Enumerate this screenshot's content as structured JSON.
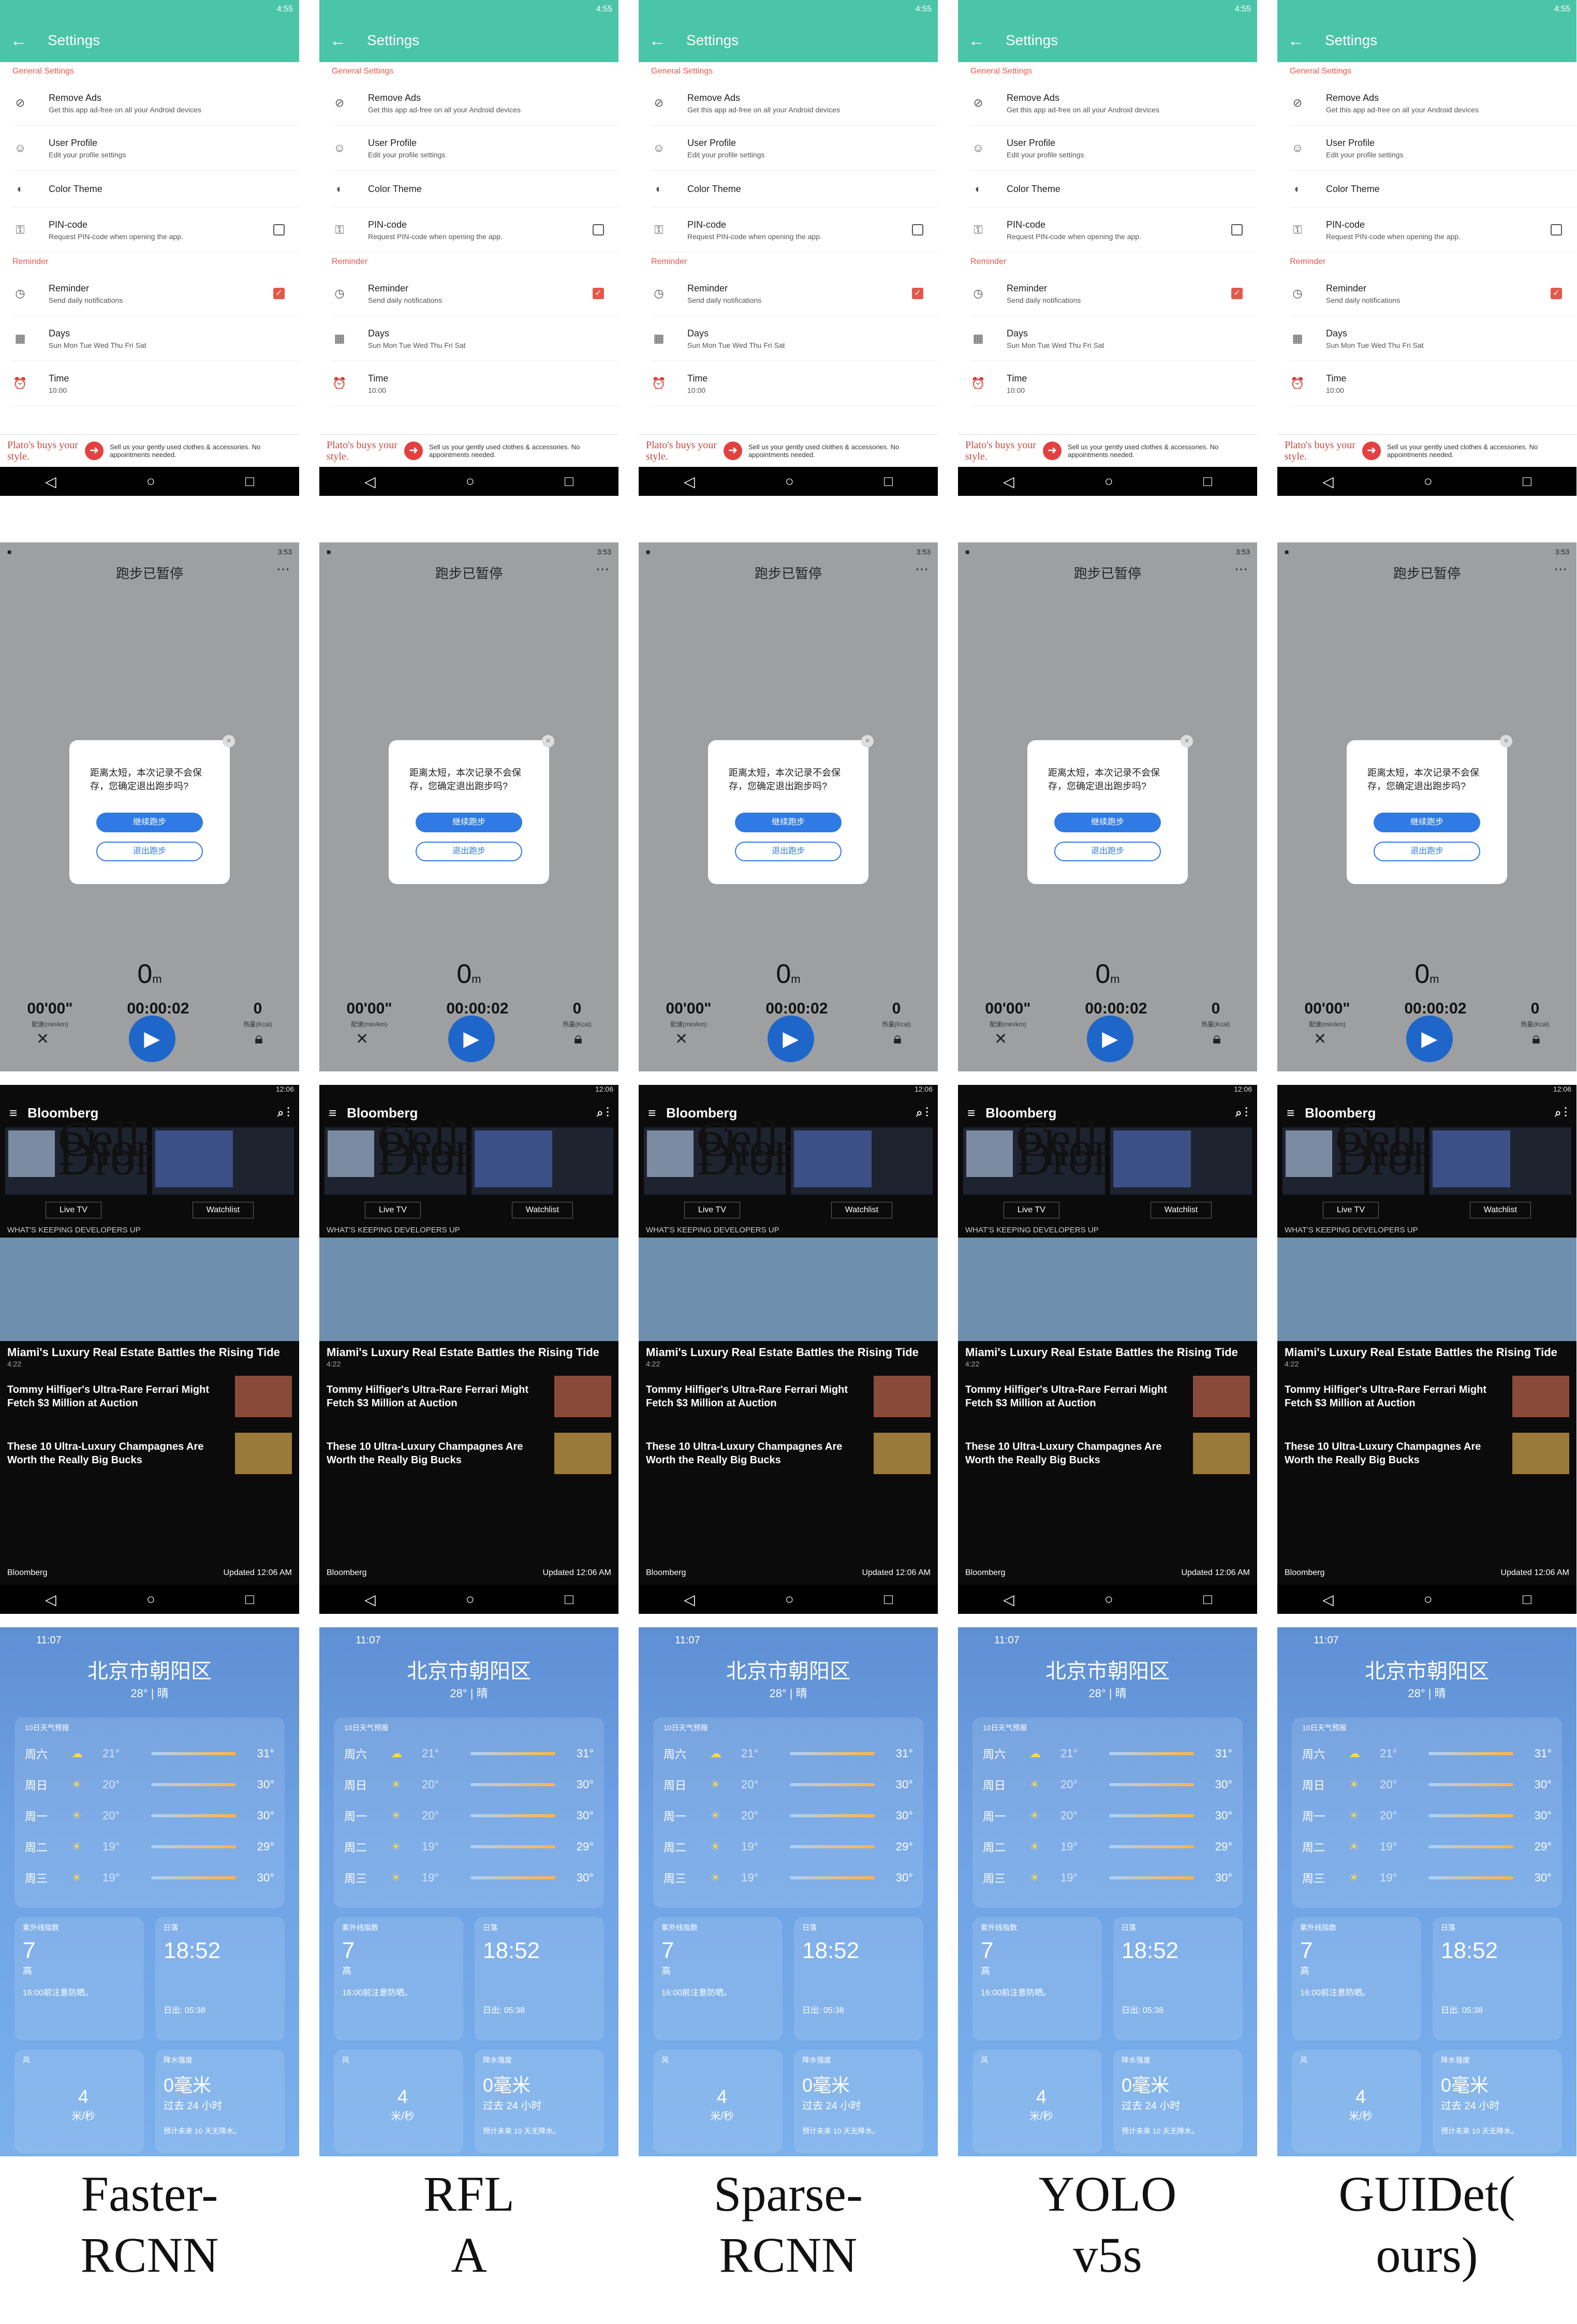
{
  "settings": {
    "time": "4:55",
    "title": "Settings",
    "section_general": "General Settings",
    "items": [
      {
        "title": "Remove Ads",
        "sub": "Get this app ad-free on all your Android devices",
        "icon": "ad-icon"
      },
      {
        "title": "User Profile",
        "sub": "Edit your profile settings",
        "icon": "person-icon"
      },
      {
        "title": "Color Theme",
        "sub": "",
        "icon": "palette-icon"
      },
      {
        "title": "PIN-code",
        "sub": "Request PIN-code when opening the app.",
        "icon": "key-icon"
      }
    ],
    "section_reminder": "Reminder",
    "reminder_items": [
      {
        "title": "Reminder",
        "sub": "Send daily notifications",
        "icon": "clock-icon"
      },
      {
        "title": "Days",
        "sub": "Sun Mon Tue Wed Thu Fri Sat",
        "icon": "calendar-icon"
      },
      {
        "title": "Time",
        "sub": "10:00",
        "icon": "alarm-icon"
      }
    ],
    "ad_brand": "Plato's buys your style.",
    "ad_text": "Sell us your gently used clothes & accessories. No appointments needed."
  },
  "running": {
    "time": "3:53",
    "title": "跑步已暂停",
    "dialog_msg": "距离太短，本次记录不会保存，您确定退出跑步吗?",
    "btn_continue": "继续跑步",
    "btn_exit": "退出跑步",
    "distance": "0",
    "distance_unit": "m",
    "pace": "00'00\"",
    "pace_label": "配速(min/km)",
    "duration": "00:00:02",
    "duration_label": "时长",
    "calories": "0",
    "calories_label": "热量(Kcal)"
  },
  "bloomberg": {
    "time": "12:06",
    "brand": "Bloomberg",
    "card1": "Cell Phone Drones",
    "live_tv": "Live TV",
    "watchlist": "Watchlist",
    "section_label": "WHAT'S KEEPING DEVELOPERS UP",
    "headline": "Miami's Luxury Real Estate Battles the Rising Tide",
    "headline_time": "4:22",
    "story1": "Tommy Hilfiger's Ultra-Rare Ferrari Might Fetch $3 Million at Auction",
    "story2": "These 10 Ultra-Luxury Champagnes Are Worth the Really Big Bucks",
    "footer_left": "Bloomberg",
    "footer_right": "Updated 12:06 AM"
  },
  "weather": {
    "time": "11:07",
    "city": "北京市朝阳区",
    "summary": "28° | 晴",
    "forecast_header": "10日天气预报",
    "days": [
      {
        "day": "周六",
        "lo": "21°",
        "hi": "31°",
        "icon": "cloud-sun-icon"
      },
      {
        "day": "周日",
        "lo": "20°",
        "hi": "30°",
        "icon": "sun-icon"
      },
      {
        "day": "周一",
        "lo": "20°",
        "hi": "30°",
        "icon": "sun-icon"
      },
      {
        "day": "周二",
        "lo": "19°",
        "hi": "29°",
        "icon": "sun-icon"
      },
      {
        "day": "周三",
        "lo": "19°",
        "hi": "30°",
        "icon": "sun-icon"
      }
    ],
    "uv_header": "紫外线指数",
    "uv_value": "7",
    "uv_level": "高",
    "uv_note": "16:00前注意防晒。",
    "sun_header": "日落",
    "sun_value": "18:52",
    "sun_note": "日出: 05:38",
    "wind_header": "风",
    "wind_value": "4",
    "wind_unit": "米/秒",
    "rain_header": "降水强度",
    "rain_value": "0毫米",
    "rain_sub": "过去 24 小时",
    "rain_note": "预计未来 10 天无降水。"
  },
  "captions": [
    {
      "line1": "Faster-",
      "line2": "RCNN"
    },
    {
      "line1": "RFL",
      "line2": "A"
    },
    {
      "line1": "Sparse-",
      "line2": "RCNN"
    },
    {
      "line1": "YOLO",
      "line2": "v5s"
    },
    {
      "line1": "GUIDet(",
      "line2": "ours)"
    }
  ]
}
